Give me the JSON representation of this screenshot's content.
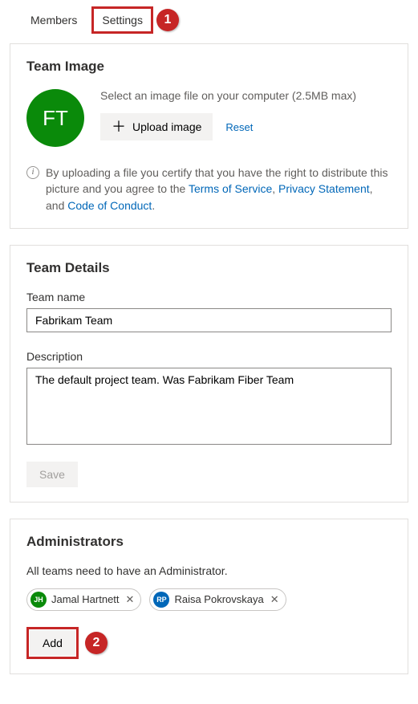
{
  "tabs": {
    "members": "Members",
    "settings": "Settings"
  },
  "callouts": {
    "one": "1",
    "two": "2"
  },
  "teamImage": {
    "heading": "Team Image",
    "avatarInitials": "FT",
    "helper": "Select an image file on your computer (2.5MB max)",
    "uploadLabel": "Upload image",
    "resetLabel": "Reset",
    "certPrefix": "By uploading a file you certify that you have the right to distribute this picture and you agree to the ",
    "tosLabel": "Terms of Service",
    "sep1": ", ",
    "privacyLabel": "Privacy Statement",
    "sep2": ", and ",
    "cocLabel": "Code of Conduct",
    "period": "."
  },
  "teamDetails": {
    "heading": "Team Details",
    "nameLabel": "Team name",
    "nameValue": "Fabrikam Team",
    "descLabel": "Description",
    "descValue": "The default project team. Was Fabrikam Fiber Team",
    "saveLabel": "Save"
  },
  "admins": {
    "heading": "Administrators",
    "desc": "All teams need to have an Administrator.",
    "list": [
      {
        "initials": "JH",
        "name": "Jamal Hartnett",
        "color": "green"
      },
      {
        "initials": "RP",
        "name": "Raisa Pokrovskaya",
        "color": "blue"
      }
    ],
    "addLabel": "Add"
  }
}
